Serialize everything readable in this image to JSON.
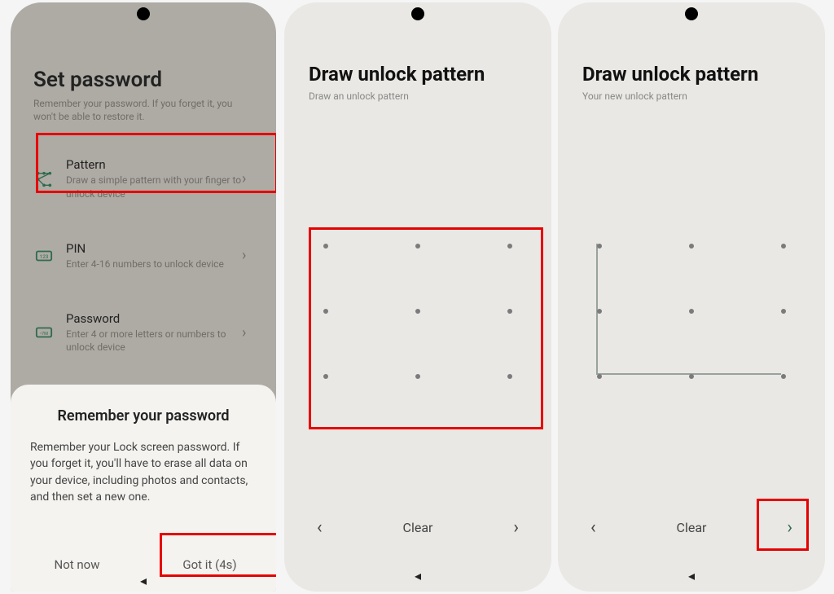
{
  "phone1": {
    "title": "Set password",
    "subtitle": "Remember your password. If you forget it, you won't be able to restore it.",
    "options": [
      {
        "title": "Pattern",
        "sub": "Draw a simple pattern with your finger to unlock device"
      },
      {
        "title": "PIN",
        "sub": "Enter 4-16 numbers to unlock device"
      },
      {
        "title": "Password",
        "sub": "Enter 4 or more letters or numbers to unlock device"
      }
    ],
    "sheet": {
      "title": "Remember your password",
      "body": "Remember your Lock screen password. If you forget it, you'll have to erase all data on your device, including photos and contacts, and then set a new one.",
      "not_now": "Not now",
      "got_it": "Got it (4s)"
    }
  },
  "phone2": {
    "title": "Draw unlock pattern",
    "subtitle": "Draw an unlock pattern",
    "clear": "Clear"
  },
  "phone3": {
    "title": "Draw unlock pattern",
    "subtitle": "Your new unlock pattern",
    "clear": "Clear"
  }
}
